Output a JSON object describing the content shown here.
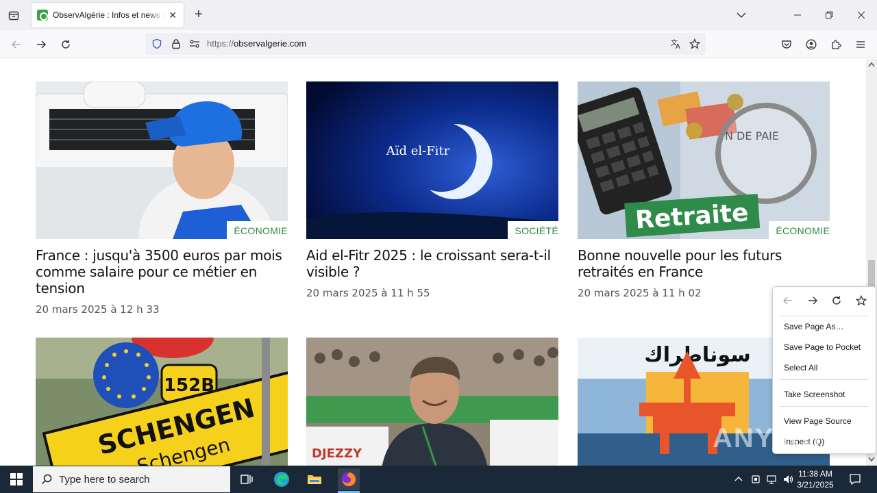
{
  "browser": {
    "tab_title": "ObservAlgérie : Infos et news p",
    "url_prefix": "https://",
    "url_domain": "observalgerie.com"
  },
  "articles": [
    {
      "category": "ÉCONOMIE",
      "headline": "France : jusqu'à 3500 euros par mois comme salaire pour ce métier en tension",
      "date": "20 mars 2025 à 12 h 33",
      "image_caption": ""
    },
    {
      "category": "SOCIÉTÉ",
      "headline": "Aid el-Fitr 2025 : le croissant sera-t-il visible ?",
      "date": "20 mars 2025 à 11 h 55",
      "image_caption": "Aïd el-Fitr"
    },
    {
      "category": "ÉCONOMIE",
      "headline": "Bonne nouvelle pour les futurs retraités en France",
      "date": "20 mars 2025 à 11 h 02",
      "image_caption": "Retraite"
    }
  ],
  "images_row2": {
    "sign_number": "152B",
    "sign_line1": "SCHENGEN",
    "sign_line2": "Schengen",
    "djezzy": "DJEZZY",
    "arabic": "سوناطراك"
  },
  "context_menu": {
    "items": [
      "Save Page As…",
      "Save Page to Pocket",
      "Select All",
      "Take Screenshot",
      "View Page Source",
      "Inspect (Q)"
    ]
  },
  "watermark": "ANY.RUN",
  "taskbar": {
    "search_placeholder": "Type here to search",
    "time": "11:38 AM",
    "date": "3/21/2025"
  },
  "colors": {
    "category_green": "#2d8a3e",
    "taskbar": "#1b2838"
  }
}
